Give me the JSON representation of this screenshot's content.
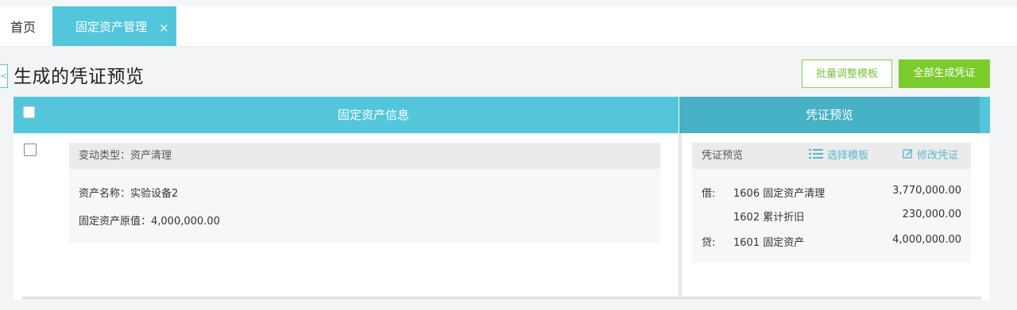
{
  "tabs": {
    "home": "首页",
    "active": "固定资产管理",
    "close_glyph": "×"
  },
  "header": {
    "back_glyph": "<",
    "title": "生成的凭证预览",
    "btn_batch": "批量调整模板",
    "btn_generate_all": "全部生成凭证"
  },
  "table": {
    "col_asset_info": "固定资产信息",
    "col_voucher_preview": "凭证预览"
  },
  "record": {
    "change_type": "变动类型：资产清理",
    "asset_name": "资产名称：实验设备2",
    "original_value": "固定资产原值：4,000,000.00"
  },
  "voucher": {
    "title": "凭证预览",
    "select_template_icon": "list-icon",
    "select_template": "选择模板",
    "edit_icon": "edit-icon",
    "edit": "修改凭证",
    "entries": [
      {
        "dc": "借:",
        "account": "1606 固定资产清理",
        "amount": "3,770,000.00"
      },
      {
        "dc": "",
        "account": "1602 累计折旧",
        "amount": "230,000.00"
      },
      {
        "dc": "贷:",
        "account": "1601 固定资产",
        "amount": "4,000,000.00"
      }
    ]
  },
  "colors": {
    "accent_teal": "#53c6dc",
    "accent_teal_dark": "#47b1c5",
    "accent_green": "#7ccb2c"
  }
}
